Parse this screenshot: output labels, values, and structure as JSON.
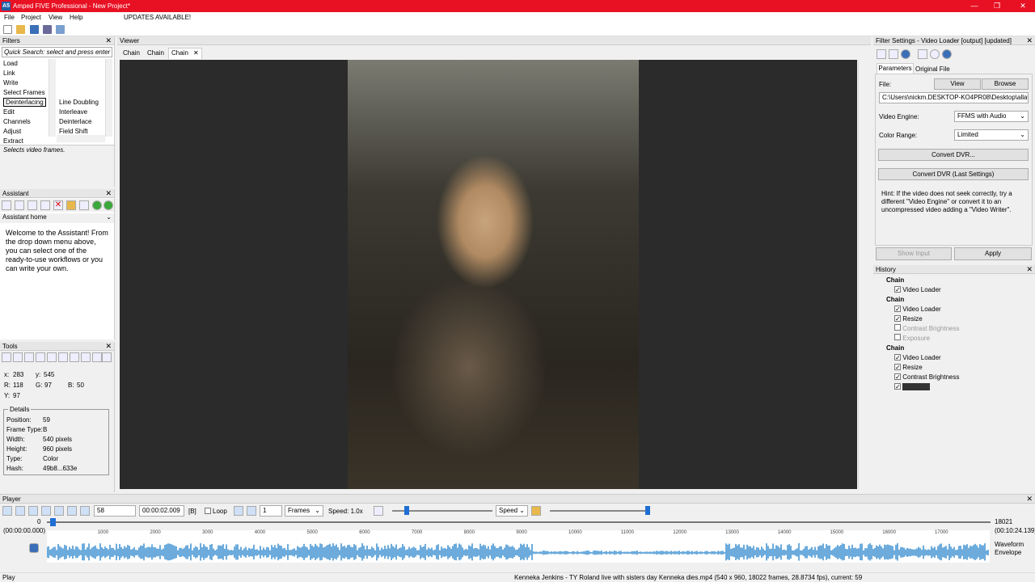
{
  "window": {
    "title": "Amped FIVE Professional - New Project*",
    "logo": "A5"
  },
  "menu": [
    "File",
    "Project",
    "View",
    "Help"
  ],
  "updates": "UPDATES AVAILABLE!",
  "filters": {
    "title": "Filters",
    "search_placeholder": "Quick Search: select and press enter",
    "categories": [
      "Load",
      "Link",
      "Write",
      "Select Frames",
      "Deinterlacing",
      "Edit",
      "Channels",
      "Adjust",
      "Extract"
    ],
    "selected_category": "Deinterlacing",
    "subitems": [
      "Line Doubling",
      "Interleave",
      "Deinterlace",
      "Field Shift"
    ],
    "description": "Selects video frames."
  },
  "assistant": {
    "title": "Assistant",
    "dropdown": "Assistant home",
    "text": "Welcome to the Assistant! From the drop down menu above, you can select one of the ready-to-use workflows or you can write your own."
  },
  "tools": {
    "title": "Tools",
    "x_label": "x:",
    "x": "283",
    "y_label": "y:",
    "y": "545",
    "r_label": "R:",
    "r": "118",
    "g_label": "G:",
    "g": "97",
    "b_label": "B:",
    "b": "50",
    "yy_label": "Y:",
    "yy": "97",
    "details_title": "Details",
    "details": [
      {
        "k": "Position:",
        "v": "59"
      },
      {
        "k": "Frame Type:",
        "v": "B"
      },
      {
        "k": "Width:",
        "v": "540 pixels"
      },
      {
        "k": "Height:",
        "v": "960 pixels"
      },
      {
        "k": "Type:",
        "v": "Color"
      },
      {
        "k": "Hash:",
        "v": "49b8...633e"
      }
    ]
  },
  "viewer": {
    "title": "Viewer",
    "tabs": [
      "Chain",
      "Chain",
      "Chain"
    ],
    "close": "✕"
  },
  "filter_settings": {
    "title": "Filter Settings - Video Loader [output] [updated]",
    "tabs": [
      "Parameters",
      "Original File"
    ],
    "file_label": "File:",
    "view_btn": "View",
    "browse_btn": "Browse",
    "file_path": "C:\\Users\\nickm.DESKTOP-KO4PR08\\Desktop\\allavs",
    "engine_label": "Video Engine:",
    "engine_value": "FFMS with Audio",
    "range_label": "Color Range:",
    "range_value": "Limited",
    "convert_btn": "Convert DVR...",
    "convert_last_btn": "Convert DVR (Last Settings)",
    "hint": "Hint: If the video does not seek correctly, try a different \"Video Engine\" or convert it to an uncompressed video adding a \"Video Writer\".",
    "show_input": "Show Input",
    "apply": "Apply"
  },
  "history": {
    "title": "History",
    "chains": [
      {
        "name": "Chain",
        "items": [
          {
            "label": "Video Loader",
            "on": true,
            "dim": false
          }
        ]
      },
      {
        "name": "Chain",
        "items": [
          {
            "label": "Video Loader",
            "on": true,
            "dim": false
          },
          {
            "label": "Resize",
            "on": true,
            "dim": false
          },
          {
            "label": "Contrast Brightness",
            "on": false,
            "dim": true
          },
          {
            "label": "Exposure",
            "on": false,
            "dim": true
          }
        ]
      },
      {
        "name": "Chain",
        "items": [
          {
            "label": "Video Loader",
            "on": true,
            "dim": false
          },
          {
            "label": "Resize",
            "on": true,
            "dim": false
          },
          {
            "label": "Contrast Brightness",
            "on": true,
            "dim": false
          },
          {
            "label": "Exposure",
            "on": true,
            "dim": false,
            "selected": true
          }
        ]
      }
    ]
  },
  "player": {
    "title": "Player",
    "frame": "58",
    "time": "00:00:02.009",
    "frame_type": "[B]",
    "loop_label": "Loop",
    "step": "1",
    "units": "Frames",
    "speed_label": "Speed: 1.0x",
    "speed_combo": "Speed",
    "start_frame": "0",
    "end_frame": "18021",
    "start_time": "(00:00:00.000)",
    "end_time": "(00:10:24.139)",
    "ticks": [
      "1000",
      "2000",
      "3000",
      "4000",
      "5000",
      "6000",
      "7000",
      "8000",
      "9000",
      "10000",
      "11000",
      "12000",
      "13000",
      "14000",
      "15000",
      "16000",
      "17000"
    ],
    "waveform": "Waveform",
    "envelope": "Envelope",
    "position_fraction": 0.003,
    "speed_slider_fraction": 0.12,
    "volume_fraction": 0.98
  },
  "status": {
    "left": "Play",
    "right": "Kenneka Jenkins - TY Roland live with sisters day Kenneka dies.mp4 (540 x 960, 18022 frames, 28.8734 fps), current: 59"
  },
  "colors": {
    "titlebar": "#e81123",
    "accent": "#1f5fa8",
    "waveform": "#3a8fd0",
    "viewer_bg": "#2b2b2b"
  }
}
